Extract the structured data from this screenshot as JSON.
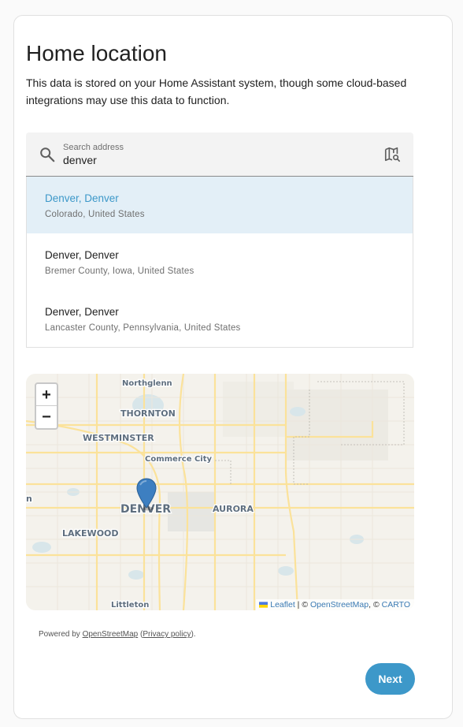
{
  "page": {
    "title": "Home location",
    "description": "This data is stored on your Home Assistant system, though some cloud-based integrations may use this data to function."
  },
  "search": {
    "label": "Search address",
    "value": "denver",
    "icon": "search-icon",
    "map_icon": "map-search-icon"
  },
  "results": [
    {
      "primary": "Denver, Denver",
      "secondary": "Colorado, United States",
      "selected": true
    },
    {
      "primary": "Denver, Denver",
      "secondary": "Bremer County, Iowa, United States",
      "selected": false
    },
    {
      "primary": "Denver, Denver",
      "secondary": "Lancaster County, Pennsylvania, United States",
      "selected": false
    }
  ],
  "map": {
    "zoom_in": "+",
    "zoom_out": "−",
    "labels": {
      "northglenn": "Northglenn",
      "thornton": "THORNTON",
      "westminster": "WESTMINSTER",
      "commerce_city": "Commerce City",
      "denver": "DENVER",
      "aurora": "AURORA",
      "lakewood": "LAKEWOOD",
      "littleton": "Littleton",
      "edge_n": "n"
    },
    "attribution": {
      "leaflet": "Leaflet",
      "sep1": " | © ",
      "osm": "OpenStreetMap",
      "sep2": ", © ",
      "carto": "CARTO"
    },
    "marker_color": "#3d7fc1"
  },
  "powered": {
    "prefix": "Powered by ",
    "osm": "OpenStreetMap",
    "open_paren": " (",
    "privacy": "Privacy policy",
    "close_paren": ")."
  },
  "actions": {
    "next_label": "Next"
  },
  "colors": {
    "accent": "#3d98c9",
    "selected_bg": "#e3eff7"
  }
}
